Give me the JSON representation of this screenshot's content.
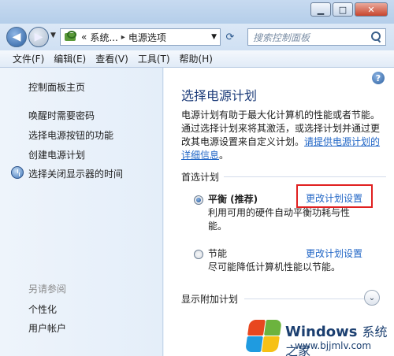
{
  "window": {
    "minimize_glyph": "▁",
    "maximize_glyph": "□",
    "close_glyph": "✕"
  },
  "addressbar": {
    "crumb1": "系统...",
    "crumb2": "电源选项",
    "crumb_prefix": "«",
    "sep": "▸",
    "search_placeholder": "搜索控制面板"
  },
  "menu": {
    "items": [
      "文件(F)",
      "编辑(E)",
      "查看(V)",
      "工具(T)",
      "帮助(H)"
    ]
  },
  "sidebar": {
    "home": "控制面板主页",
    "links": [
      "唤醒时需要密码",
      "选择电源按钮的功能",
      "创建电源计划",
      "选择关闭显示器的时间"
    ],
    "see_also_header": "另请参阅",
    "see_also": [
      "个性化",
      "用户帐户"
    ]
  },
  "main": {
    "help_glyph": "?",
    "title": "选择电源计划",
    "desc_lines": [
      "电源计划有助于最大化计算机的性能或者节能。",
      "通过选择计划来将其激活，或选择计划并通过更",
      "改其电源设置来自定义计划。"
    ],
    "desc_link": "请提供电源计划的",
    "desc_link2": "详细信息",
    "desc_end": "。",
    "section_label": "首选计划",
    "plans": [
      {
        "name": "平衡 (推荐)",
        "selected": true,
        "desc_line1": "利用可用的硬件自动平衡功耗与性",
        "desc_line2": "能。",
        "link": "更改计划设置"
      },
      {
        "name": "节能",
        "selected": false,
        "desc_line1": "尽可能降低计算机性能以节能。",
        "desc_line2": "",
        "link": "更改计划设置"
      }
    ],
    "expand_label": "显示附加计划",
    "chevron_glyph": "⌄",
    "highlight_color": "#e02020"
  },
  "watermark": {
    "brand": "Windows",
    "brand_cn": "系统之家",
    "url": "www.bjjmlv.com"
  }
}
